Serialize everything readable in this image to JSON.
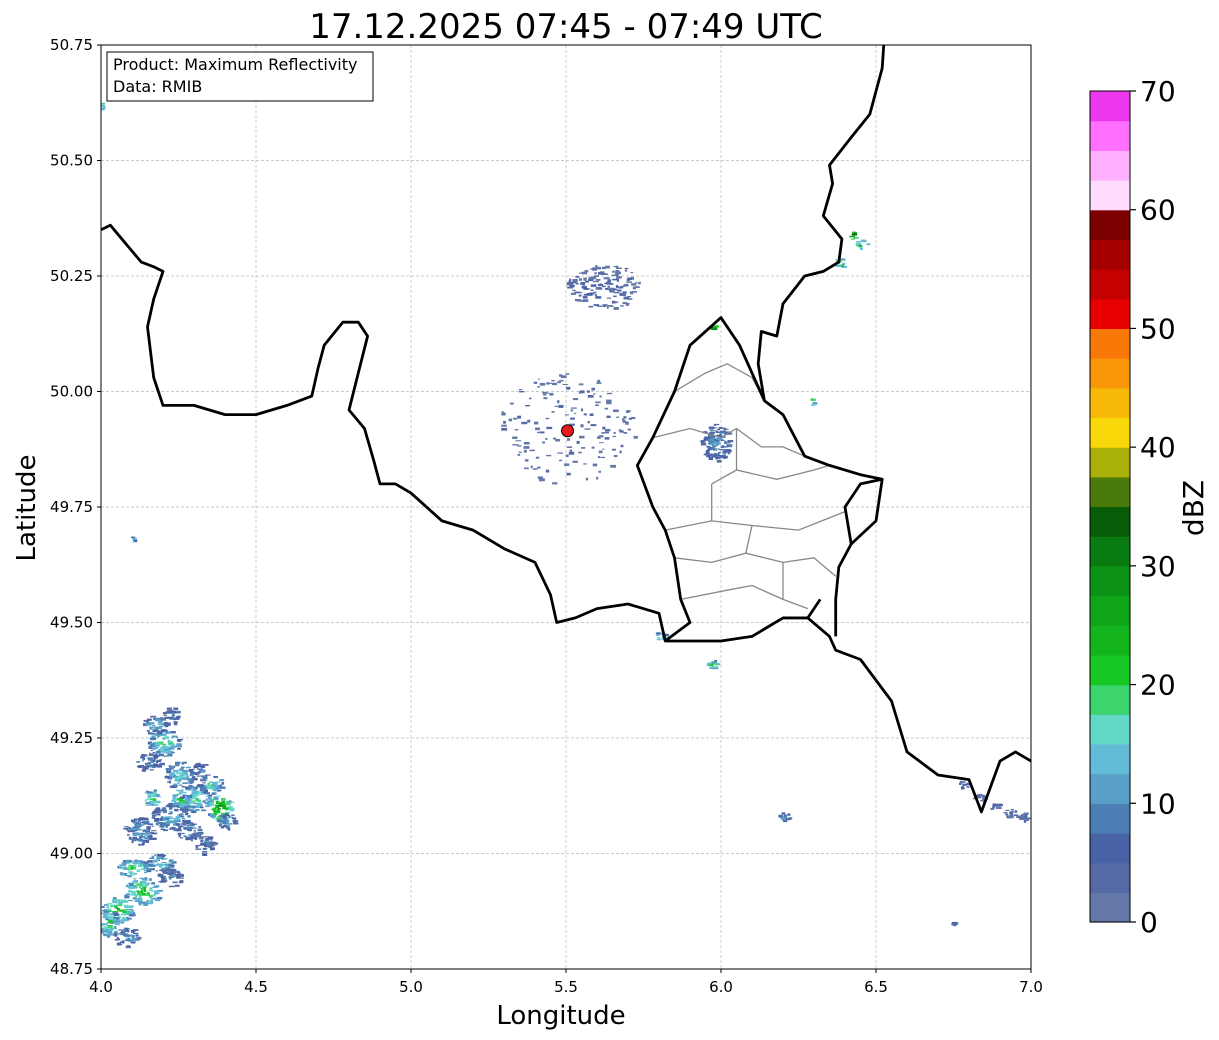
{
  "title": "17.12.2025 07:45 - 07:49 UTC",
  "info_box": {
    "product": "Product: Maximum Reflectivity",
    "data": "Data: RMIB"
  },
  "map_data": {
    "x_label": "Longitude",
    "y_label": "Latitude",
    "x_range": [
      4.0,
      7.0
    ],
    "y_range": [
      48.75,
      50.75
    ],
    "x_ticks": [
      "4.0",
      "4.5",
      "5.0",
      "5.5",
      "6.0",
      "6.5",
      "7.0"
    ],
    "y_ticks": [
      "48.75",
      "49.00",
      "49.25",
      "49.50",
      "49.75",
      "50.00",
      "50.25",
      "50.50",
      "50.75"
    ],
    "grid": true,
    "radar_site": {
      "lon": 5.505,
      "lat": 49.915
    },
    "colorbar": {
      "label": "dBZ",
      "min": 0,
      "max": 70,
      "step": 2.5,
      "ticks": [
        "0",
        "10",
        "20",
        "30",
        "40",
        "50",
        "60",
        "70"
      ],
      "colors": [
        "#6478a8",
        "#5569a6",
        "#4763a5",
        "#4c80b5",
        "#58a0c8",
        "#62bcd8",
        "#62d8c8",
        "#3cd46c",
        "#16c824",
        "#14b41c",
        "#10a418",
        "#0c9214",
        "#087c10",
        "#065c08",
        "#4a7a0a",
        "#aab00a",
        "#f8d808",
        "#f8b808",
        "#f89808",
        "#f87808",
        "#e80000",
        "#c40000",
        "#a40000",
        "#7c0000",
        "#ffdcff",
        "#ffb0ff",
        "#ff70ff",
        "#ee38ee"
      ]
    },
    "borders": {
      "national": [
        [
          [
            4.0,
            50.35
          ],
          [
            4.03,
            50.36
          ],
          [
            4.08,
            50.32
          ],
          [
            4.13,
            50.28
          ],
          [
            4.17,
            50.27
          ],
          [
            4.2,
            50.26
          ],
          [
            4.17,
            50.2
          ],
          [
            4.15,
            50.14
          ],
          [
            4.17,
            50.03
          ],
          [
            4.2,
            49.97
          ],
          [
            4.3,
            49.97
          ],
          [
            4.4,
            49.95
          ],
          [
            4.5,
            49.95
          ],
          [
            4.6,
            49.97
          ],
          [
            4.68,
            49.99
          ],
          [
            4.7,
            50.05
          ],
          [
            4.72,
            50.1
          ],
          [
            4.78,
            50.15
          ],
          [
            4.83,
            50.15
          ],
          [
            4.86,
            50.12
          ],
          [
            4.83,
            50.04
          ],
          [
            4.8,
            49.96
          ],
          [
            4.85,
            49.92
          ],
          [
            4.88,
            49.85
          ],
          [
            4.9,
            49.8
          ],
          [
            4.95,
            49.8
          ],
          [
            5.0,
            49.78
          ],
          [
            5.1,
            49.72
          ],
          [
            5.2,
            49.7
          ],
          [
            5.3,
            49.66
          ],
          [
            5.4,
            49.63
          ],
          [
            5.45,
            49.56
          ],
          [
            5.47,
            49.5
          ],
          [
            5.53,
            49.51
          ],
          [
            5.6,
            49.53
          ],
          [
            5.7,
            49.54
          ],
          [
            5.8,
            49.52
          ],
          [
            5.82,
            49.46
          ],
          [
            5.9,
            49.46
          ],
          [
            6.0,
            49.46
          ],
          [
            6.1,
            49.47
          ],
          [
            6.2,
            49.51
          ],
          [
            6.28,
            49.51
          ],
          [
            6.35,
            49.47
          ],
          [
            6.37,
            49.44
          ],
          [
            6.45,
            49.42
          ],
          [
            6.55,
            49.33
          ],
          [
            6.6,
            49.22
          ],
          [
            6.7,
            49.17
          ],
          [
            6.8,
            49.16
          ],
          [
            6.84,
            49.09
          ],
          [
            6.9,
            49.2
          ],
          [
            6.95,
            49.22
          ],
          [
            7.0,
            49.2
          ]
        ],
        [
          [
            6.53,
            50.8
          ],
          [
            6.52,
            50.7
          ],
          [
            6.5,
            50.65
          ],
          [
            6.48,
            50.6
          ],
          [
            6.42,
            50.55
          ],
          [
            6.35,
            50.49
          ],
          [
            6.36,
            50.45
          ],
          [
            6.33,
            50.38
          ],
          [
            6.39,
            50.33
          ],
          [
            6.38,
            50.28
          ],
          [
            6.33,
            50.26
          ],
          [
            6.27,
            50.25
          ],
          [
            6.2,
            50.19
          ],
          [
            6.18,
            50.12
          ],
          [
            6.13,
            50.13
          ],
          [
            6.12,
            50.06
          ],
          [
            6.14,
            49.98
          ],
          [
            6.2,
            49.95
          ],
          [
            6.27,
            49.86
          ],
          [
            6.35,
            49.84
          ],
          [
            6.45,
            49.82
          ],
          [
            6.52,
            49.81
          ],
          [
            6.5,
            49.72
          ],
          [
            6.42,
            49.67
          ],
          [
            6.38,
            49.62
          ],
          [
            6.37,
            49.55
          ],
          [
            6.37,
            49.47
          ]
        ],
        [
          [
            6.52,
            49.81
          ],
          [
            6.45,
            49.8
          ],
          [
            6.4,
            49.75
          ],
          [
            6.42,
            49.67
          ]
        ],
        [
          [
            6.14,
            49.98
          ],
          [
            6.06,
            50.1
          ],
          [
            6.0,
            50.16
          ],
          [
            5.9,
            50.1
          ],
          [
            5.85,
            50.0
          ],
          [
            5.78,
            49.9
          ],
          [
            5.73,
            49.84
          ],
          [
            5.78,
            49.75
          ],
          [
            5.82,
            49.7
          ],
          [
            5.85,
            49.64
          ],
          [
            5.87,
            49.55
          ],
          [
            5.9,
            49.5
          ],
          [
            5.82,
            49.46
          ]
        ],
        [
          [
            6.2,
            49.51
          ],
          [
            6.28,
            49.51
          ],
          [
            6.32,
            49.55
          ]
        ]
      ],
      "regional": [
        [
          [
            5.85,
            50.0
          ],
          [
            5.95,
            50.04
          ],
          [
            6.02,
            50.06
          ],
          [
            6.1,
            50.03
          ],
          [
            6.14,
            49.98
          ]
        ],
        [
          [
            5.78,
            49.9
          ],
          [
            5.9,
            49.92
          ],
          [
            6.0,
            49.9
          ],
          [
            6.05,
            49.92
          ],
          [
            6.13,
            49.88
          ],
          [
            6.2,
            49.88
          ],
          [
            6.27,
            49.86
          ]
        ],
        [
          [
            5.97,
            49.8
          ],
          [
            6.05,
            49.83
          ],
          [
            6.18,
            49.81
          ],
          [
            6.3,
            49.83
          ],
          [
            6.35,
            49.84
          ]
        ],
        [
          [
            5.82,
            49.7
          ],
          [
            5.97,
            49.72
          ],
          [
            6.1,
            49.71
          ],
          [
            6.25,
            49.7
          ],
          [
            6.4,
            49.74
          ]
        ],
        [
          [
            5.85,
            49.64
          ],
          [
            5.97,
            49.63
          ],
          [
            6.08,
            49.65
          ],
          [
            6.2,
            49.63
          ],
          [
            6.3,
            49.64
          ],
          [
            6.37,
            49.6
          ]
        ],
        [
          [
            5.87,
            49.55
          ],
          [
            6.02,
            49.57
          ],
          [
            6.1,
            49.58
          ],
          [
            6.2,
            49.55
          ],
          [
            6.28,
            49.53
          ]
        ],
        [
          [
            5.97,
            49.8
          ],
          [
            5.97,
            49.72
          ]
        ],
        [
          [
            6.1,
            49.71
          ],
          [
            6.08,
            49.65
          ]
        ],
        [
          [
            6.05,
            49.92
          ],
          [
            6.05,
            49.83
          ]
        ],
        [
          [
            6.2,
            49.63
          ],
          [
            6.2,
            49.55
          ]
        ]
      ]
    },
    "echoes": [
      [
        4.2,
        49.24,
        0.05,
        0.03,
        20
      ],
      [
        4.17,
        49.28,
        0.04,
        0.02,
        14
      ],
      [
        4.15,
        49.2,
        0.04,
        0.02,
        10
      ],
      [
        4.25,
        49.17,
        0.05,
        0.03,
        16
      ],
      [
        4.3,
        49.12,
        0.05,
        0.03,
        18
      ],
      [
        4.38,
        49.1,
        0.04,
        0.03,
        30
      ],
      [
        4.35,
        49.15,
        0.04,
        0.02,
        18
      ],
      [
        4.22,
        49.08,
        0.06,
        0.03,
        14
      ],
      [
        4.12,
        49.05,
        0.05,
        0.03,
        12
      ],
      [
        4.18,
        48.98,
        0.05,
        0.02,
        16
      ],
      [
        4.1,
        48.97,
        0.05,
        0.02,
        22
      ],
      [
        4.13,
        48.92,
        0.06,
        0.03,
        24
      ],
      [
        4.05,
        48.88,
        0.05,
        0.03,
        26
      ],
      [
        4.02,
        48.85,
        0.03,
        0.03,
        22
      ],
      [
        4.08,
        48.82,
        0.04,
        0.02,
        12
      ],
      [
        4.22,
        48.95,
        0.04,
        0.02,
        10
      ],
      [
        4.28,
        49.05,
        0.04,
        0.02,
        10
      ],
      [
        4.33,
        49.02,
        0.03,
        0.02,
        8
      ],
      [
        4.4,
        49.07,
        0.03,
        0.02,
        12
      ],
      [
        4.22,
        49.3,
        0.03,
        0.02,
        8
      ],
      [
        4.31,
        49.18,
        0.03,
        0.02,
        10
      ],
      [
        4.16,
        49.12,
        0.03,
        0.02,
        22
      ],
      [
        4.25,
        49.12,
        0.03,
        0.02,
        24
      ],
      [
        6.83,
        49.12,
        0.02,
        0.01,
        6
      ],
      [
        6.88,
        49.1,
        0.02,
        0.01,
        6
      ],
      [
        6.93,
        49.09,
        0.02,
        0.01,
        6
      ],
      [
        6.97,
        49.08,
        0.02,
        0.01,
        6
      ],
      [
        6.78,
        49.15,
        0.015,
        0.01,
        6
      ],
      [
        6.45,
        50.32,
        0.02,
        0.01,
        28
      ],
      [
        6.38,
        50.28,
        0.015,
        0.01,
        30
      ],
      [
        6.42,
        50.34,
        0.01,
        0.01,
        40
      ],
      [
        5.97,
        50.14,
        0.01,
        0.005,
        40
      ],
      [
        6.29,
        49.98,
        0.006,
        0.01,
        30
      ],
      [
        5.5,
        49.92,
        0.22,
        0.12,
        2
      ],
      [
        5.62,
        50.23,
        0.12,
        0.05,
        4
      ],
      [
        5.98,
        49.89,
        0.05,
        0.04,
        10
      ],
      [
        6.2,
        49.08,
        0.02,
        0.01,
        12
      ],
      [
        5.97,
        49.41,
        0.02,
        0.01,
        24
      ],
      [
        5.8,
        49.47,
        0.02,
        0.01,
        22
      ],
      [
        4.0,
        50.62,
        0.006,
        0.01,
        24
      ],
      [
        4.1,
        49.68,
        0.005,
        0.008,
        22
      ],
      [
        6.75,
        48.85,
        0.01,
        0.005,
        10
      ]
    ]
  }
}
